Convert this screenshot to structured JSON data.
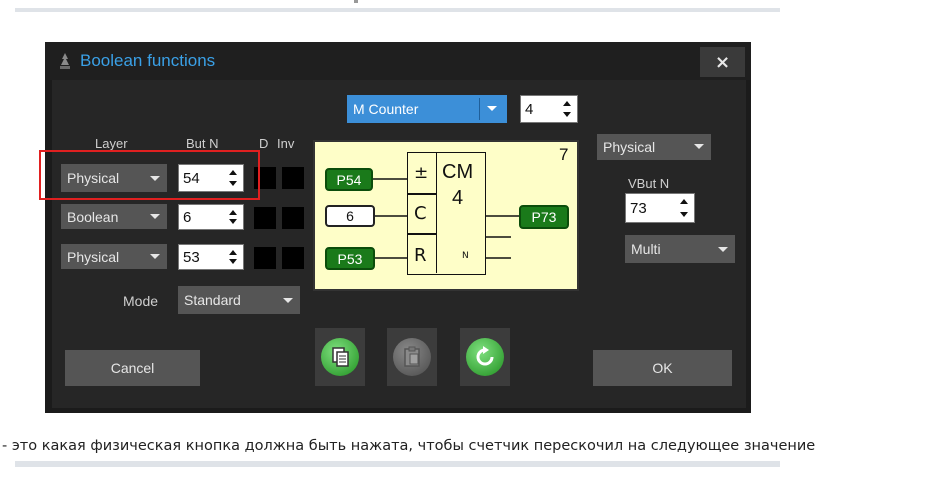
{
  "dialog": {
    "title": "Boolean functions",
    "close": "×",
    "counter_type": "M Counter",
    "counter_value": "4",
    "headers": {
      "layer": "Layer",
      "but_n": "But N",
      "d": "D",
      "inv": "Inv"
    },
    "rows": [
      {
        "layer": "Physical",
        "but_n": "54"
      },
      {
        "layer": "Boolean",
        "but_n": "6"
      },
      {
        "layer": "Physical",
        "but_n": "53"
      }
    ],
    "mode_label": "Mode",
    "mode_value": "Standard",
    "right": {
      "layer": "Physical",
      "vbut_label": "VBut N",
      "vbut_value": "73",
      "multi": "Multi"
    },
    "diagram": {
      "index": "7",
      "pins_in": [
        "P54",
        "6",
        "P53"
      ],
      "pin_out": "P73",
      "block_sym": [
        "±",
        "C",
        "R"
      ],
      "block_name": "CM",
      "block_num": "4",
      "n_label": "N"
    },
    "cancel": "Cancel",
    "ok": "OK"
  },
  "caption": "- это какая физическая кнопка должна быть нажата, чтобы счетчик перескочил на следующее значение",
  "colors": {
    "accent": "#3aa0e6",
    "highlight": "#e02020",
    "pin_green": "#1a7a1a",
    "diagram_bg": "#fefec8"
  }
}
